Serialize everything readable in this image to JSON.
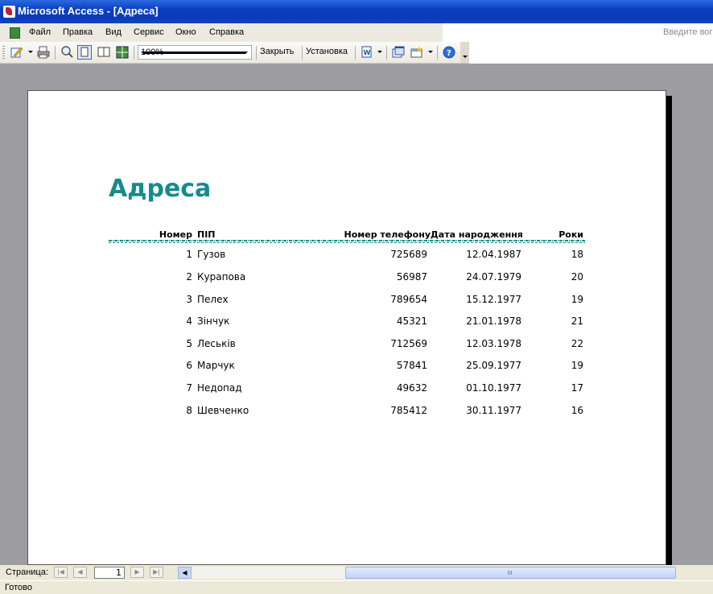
{
  "window": {
    "title": "Microsoft Access - [Адреса]"
  },
  "menu": {
    "items": [
      "Файл",
      "Правка",
      "Вид",
      "Сервис",
      "Окно",
      "Справка"
    ],
    "help_placeholder": "Введите вог"
  },
  "toolbar": {
    "zoom": "100%",
    "close_label": "Закрыть",
    "setup_label": "Установка"
  },
  "report": {
    "title": "Адреса",
    "columns": [
      "Номер",
      "ПІП",
      "Номер телефону",
      "Дата народження",
      "Роки"
    ],
    "rows": [
      [
        "1",
        "Гузов",
        "725689",
        "12.04.1987",
        "18"
      ],
      [
        "2",
        "Курапова",
        "56987",
        "24.07.1979",
        "20"
      ],
      [
        "3",
        "Пелех",
        "789654",
        "15.12.1977",
        "19"
      ],
      [
        "4",
        "Зінчук",
        "45321",
        "21.01.1978",
        "21"
      ],
      [
        "5",
        "Леськів",
        "712569",
        "12.03.1978",
        "22"
      ],
      [
        "6",
        "Марчук",
        "57841",
        "25.09.1977",
        "19"
      ],
      [
        "7",
        "Недопад",
        "49632",
        "01.10.1977",
        "17"
      ],
      [
        "8",
        "Шевченко",
        "785412",
        "30.11.1977",
        "16"
      ]
    ]
  },
  "pager": {
    "label": "Страница:",
    "page": "1"
  },
  "status": {
    "text": "Готово"
  },
  "colors": {
    "accent": "#168b8b",
    "titlebar": "#0a3fbf"
  }
}
